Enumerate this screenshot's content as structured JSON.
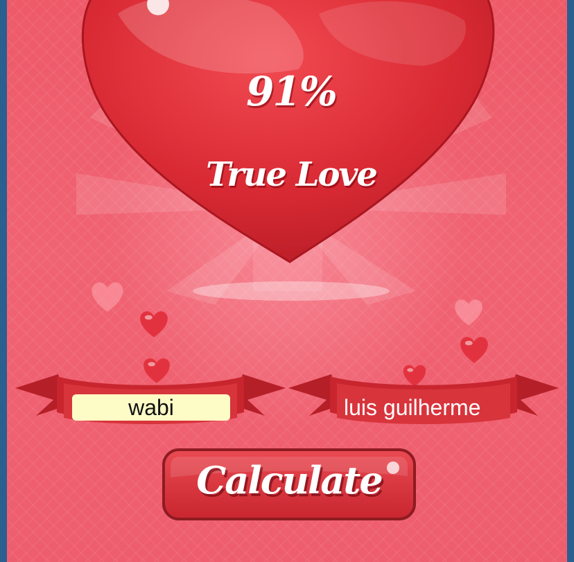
{
  "result": {
    "percent": "91%",
    "verdict": "True Love"
  },
  "inputs": {
    "name1": "wabi",
    "name2": "luis guilherme"
  },
  "button": {
    "label": "Calculate"
  },
  "colors": {
    "background": "#ef5f6f",
    "heart": "#e0323d",
    "ribbon": "#d8343c",
    "button": "#d93a42",
    "input_highlight": "#fdfbc6",
    "frame": "#2a5f8f"
  }
}
